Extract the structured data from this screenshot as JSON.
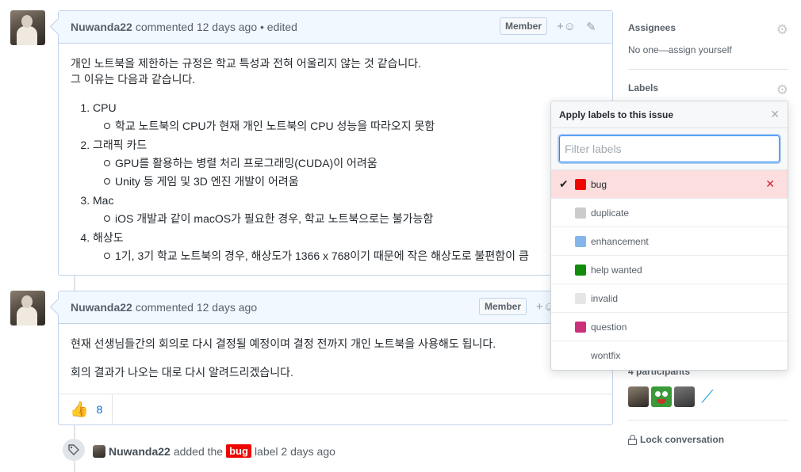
{
  "comments": [
    {
      "author": "Nuwanda22",
      "meta": "commented 12 days ago • edited",
      "badge": "Member",
      "intro": [
        "개인 노트북을 제한하는 규정은 학교 특성과 전혀 어울리지 않는 것 같습니다.",
        "그 이유는 다음과 같습니다."
      ],
      "items": [
        {
          "title": "CPU",
          "subs": [
            "학교 노트북의 CPU가 현재 개인 노트북의 CPU 성능을 따라오지 못함"
          ]
        },
        {
          "title": "그래픽 카드",
          "subs": [
            "GPU를 활용하는 병렬 처리 프로그래밍(CUDA)이 어려움",
            "Unity 등 게임 및 3D 엔진 개발이 어려움"
          ]
        },
        {
          "title": "Mac",
          "subs": [
            "iOS 개발과 같이 macOS가 필요한 경우, 학교 노트북으로는 불가능함"
          ]
        },
        {
          "title": "해상도",
          "subs": [
            "1기, 3기 학교 노트북의 경우, 해상도가 1366 x 768이기 때문에 작은 해상도로 불편함이 큼"
          ]
        }
      ]
    },
    {
      "author": "Nuwanda22",
      "meta": "commented 12 days ago",
      "badge": "Member",
      "paragraphs": [
        "현재 선생님들간의 회의로 다시 결정될 예정이며 결정 전까지 개인 노트북을 사용해도 됩니다.",
        "회의 결과가 나오는 대로 다시 알려드리겠습니다."
      ],
      "reaction_count": "8"
    }
  ],
  "event": {
    "author": "Nuwanda22",
    "text_before": "added the",
    "label": "bug",
    "text_after": "label 2 days ago"
  },
  "sidebar": {
    "assignees_title": "Assignees",
    "assignees_text": "No one—assign yourself",
    "labels_title": "Labels",
    "participants_title": "4 participants",
    "lock_text": "Lock conversation"
  },
  "popover": {
    "title": "Apply labels to this issue",
    "filter_placeholder": "Filter labels",
    "labels": [
      {
        "name": "bug",
        "color": "#ee0701",
        "selected": true
      },
      {
        "name": "duplicate",
        "color": "#cccccc",
        "selected": false
      },
      {
        "name": "enhancement",
        "color": "#84b6eb",
        "selected": false
      },
      {
        "name": "help wanted",
        "color": "#128a0c",
        "selected": false
      },
      {
        "name": "invalid",
        "color": "#e6e6e6",
        "selected": false
      },
      {
        "name": "question",
        "color": "#cc317c",
        "selected": false
      },
      {
        "name": "wontfix",
        "color": "#ffffff",
        "selected": false
      }
    ]
  },
  "icons": {
    "gear": "gear-icon",
    "reaction": "smiley-icon",
    "edit": "pencil-icon",
    "close": "close-icon",
    "check": "check-icon",
    "tag": "tag-icon",
    "thumbs": "thumbs-up-icon",
    "lock": "lock-icon"
  }
}
